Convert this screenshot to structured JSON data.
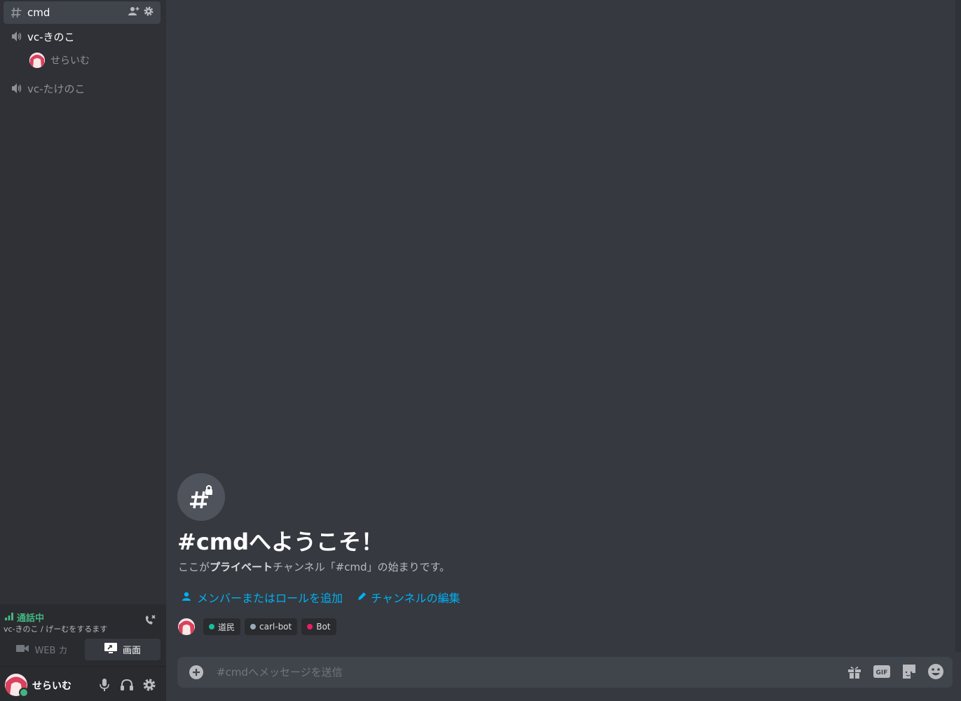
{
  "sidebar": {
    "channels": [
      {
        "name": "cmd",
        "type": "text-private",
        "active": true
      },
      {
        "name": "vc-きのこ",
        "type": "voice",
        "active": false
      },
      {
        "name": "vc-たけのこ",
        "type": "voice",
        "active": false
      }
    ],
    "voice_user": "せらいむ"
  },
  "voice_panel": {
    "status": "通話中",
    "location": "vc-きのこ / げーむをするます",
    "video_label": "WEB カ",
    "screen_label": "画面"
  },
  "user_bar": {
    "username": "せらいむ",
    "status_color": "#43b581"
  },
  "main": {
    "welcome_title": "#cmdへようこそ！",
    "welcome_sub_prefix": "ここが",
    "welcome_sub_bold": "プライベート",
    "welcome_sub_suffix": "チャンネル「#cmd」の始まりです。",
    "add_members_label": "メンバーまたはロールを追加",
    "edit_channel_label": "チャンネルの編集",
    "roles": [
      {
        "name": "道民",
        "color": "#1abc9c"
      },
      {
        "name": "carl-bot",
        "color": "#99aab5"
      },
      {
        "name": "Bot",
        "color": "#e91e63"
      }
    ],
    "composer_placeholder": "#cmdへメッセージを送信"
  },
  "colors": {
    "accent_link": "#00b0f4",
    "online": "#43b581",
    "bg_main": "#36393f",
    "bg_sidebar": "#2f3136"
  },
  "icons": [
    "hash-lock-icon",
    "speaker-icon",
    "add-member-icon",
    "gear-icon",
    "signal-icon",
    "disconnect-icon",
    "camera-icon",
    "screen-share-icon",
    "mic-icon",
    "headphones-icon",
    "plus-circle-icon",
    "gift-icon",
    "gif-icon",
    "sticker-icon",
    "emoji-icon",
    "pencil-icon"
  ]
}
